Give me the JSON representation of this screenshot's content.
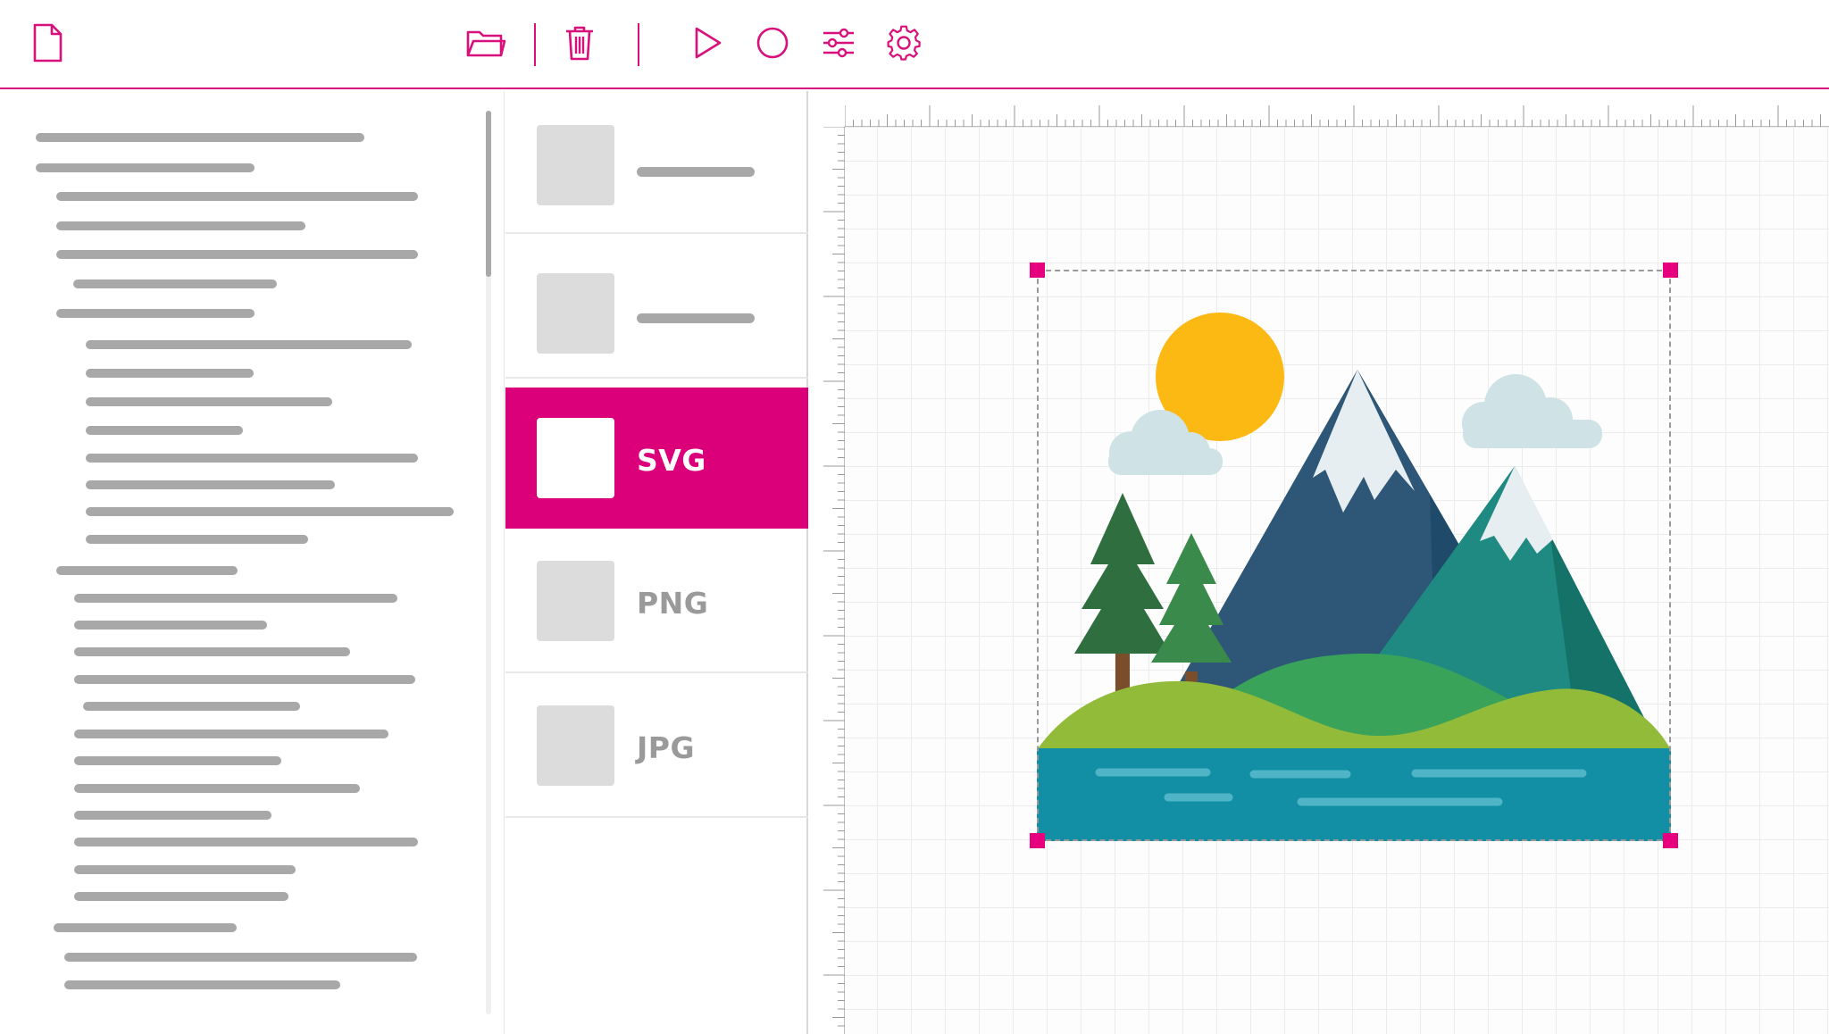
{
  "toolbar": {
    "new_icon": "file-icon",
    "open_icon": "folder-icon",
    "delete_icon": "trash-icon",
    "play_icon": "play-icon",
    "record_icon": "circle-icon",
    "adjust_icon": "sliders-icon",
    "settings_icon": "gear-icon"
  },
  "formats": {
    "items": [
      {
        "label": "",
        "active": false
      },
      {
        "label": "",
        "active": false
      },
      {
        "label": "SVG",
        "active": true
      },
      {
        "label": "PNG",
        "active": false
      },
      {
        "label": "JPG",
        "active": false
      }
    ]
  },
  "colors": {
    "accent": "#db007a",
    "handle": "#e6007e",
    "sun": "#fdb913",
    "cloud": "#cfe3e6",
    "mountain_dark": "#2e5677",
    "mountain_teal": "#1f8a82",
    "snow": "#e6eef1",
    "tree": "#2f6e3f",
    "hill_green": "#3aa35a",
    "hill_lime": "#8fb83a",
    "water": "#138fa5"
  }
}
